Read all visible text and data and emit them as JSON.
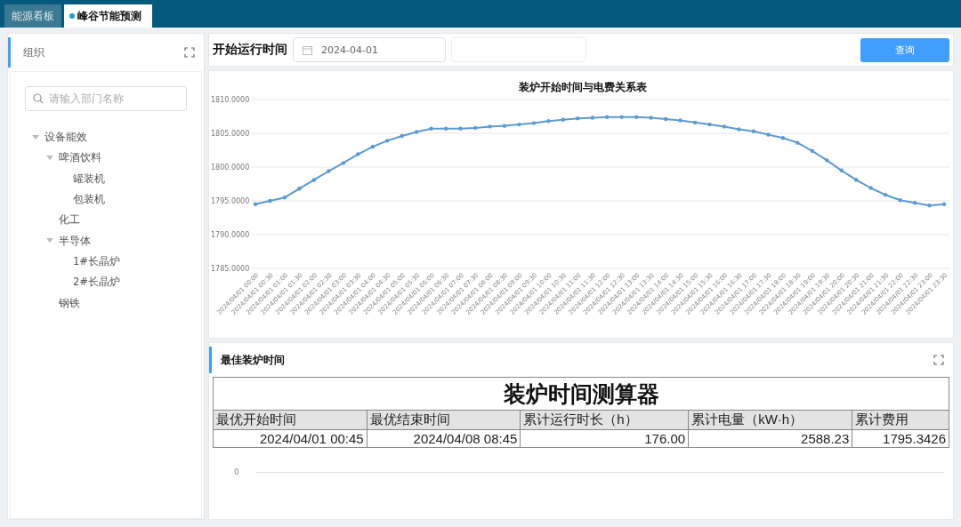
{
  "tabs": [
    {
      "label": "能源看板",
      "selected": false
    },
    {
      "label": "峰谷节能预测",
      "selected": true
    }
  ],
  "sidebar": {
    "title": "组织",
    "search": {
      "placeholder": "请输入部门名称"
    },
    "tree": [
      {
        "label": "设备能效",
        "expanded": true,
        "children": [
          {
            "label": "啤酒饮料",
            "expanded": true,
            "children": [
              {
                "label": "罐装机"
              },
              {
                "label": "包装机"
              }
            ]
          },
          {
            "label": "化工"
          },
          {
            "label": "半导体",
            "expanded": true,
            "children": [
              {
                "label": "1#长晶炉"
              },
              {
                "label": "2#长晶炉"
              }
            ]
          },
          {
            "label": "钢铁"
          }
        ]
      }
    ]
  },
  "filter": {
    "label": "开始运行时间",
    "date": "2024-04-01",
    "query_button": "查询"
  },
  "chart": {
    "chart_data": {
      "type": "line",
      "title": "装炉开始时间与电费关系表",
      "categories": [
        "2024/04/01 00:00",
        "2024/04/01 00:30",
        "2024/04/01 01:00",
        "2024/04/01 01:30",
        "2024/04/01 02:00",
        "2024/04/01 02:30",
        "2024/04/01 03:00",
        "2024/04/01 03:30",
        "2024/04/01 04:00",
        "2024/04/01 04:30",
        "2024/04/01 05:00",
        "2024/04/01 05:30",
        "2024/04/01 06:00",
        "2024/04/01 06:30",
        "2024/04/01 07:00",
        "2024/04/01 07:30",
        "2024/04/01 08:00",
        "2024/04/01 08:30",
        "2024/04/01 09:00",
        "2024/04/01 09:30",
        "2024/04/01 10:00",
        "2024/04/01 10:30",
        "2024/04/01 11:00",
        "2024/04/01 11:30",
        "2024/04/01 12:00",
        "2024/04/01 12:30",
        "2024/04/01 13:00",
        "2024/04/01 13:30",
        "2024/04/01 14:00",
        "2024/04/01 14:30",
        "2024/04/01 15:00",
        "2024/04/01 15:30",
        "2024/04/01 16:00",
        "2024/04/01 16:30",
        "2024/04/01 17:00",
        "2024/04/01 17:30",
        "2024/04/01 18:00",
        "2024/04/01 18:30",
        "2024/04/01 19:00",
        "2024/04/01 19:30",
        "2024/04/01 20:00",
        "2024/04/01 20:30",
        "2024/04/01 21:00",
        "2024/04/01 21:30",
        "2024/04/01 22:00",
        "2024/04/01 22:30",
        "2024/04/01 23:00",
        "2024/04/01 23:30"
      ],
      "grid": true,
      "series": [
        {
          "color": "#5b9bd5",
          "values": [
            1794.5,
            1795.0,
            1795.5,
            1796.8,
            1798.1,
            1799.4,
            1800.6,
            1801.9,
            1803.0,
            1803.9,
            1804.6,
            1805.2,
            1805.7,
            1805.7,
            1805.7,
            1805.8,
            1806.0,
            1806.1,
            1806.3,
            1806.5,
            1806.8,
            1807.0,
            1807.2,
            1807.3,
            1807.4,
            1807.4,
            1807.4,
            1807.3,
            1807.1,
            1806.9,
            1806.6,
            1806.3,
            1806.0,
            1805.6,
            1805.3,
            1804.8,
            1804.3,
            1803.6,
            1802.4,
            1801.0,
            1799.5,
            1798.1,
            1796.9,
            1795.9,
            1795.1,
            1794.7,
            1794.3,
            1794.5
          ]
        }
      ],
      "ylim": [
        1785,
        1810
      ],
      "yticks": [
        {
          "value": 1785,
          "label": "1785.0000"
        },
        {
          "value": 1790,
          "label": "1790.0000"
        },
        {
          "value": 1795,
          "label": "1795.0000"
        },
        {
          "value": 1800,
          "label": "1800.0000"
        },
        {
          "value": 1805,
          "label": "1805.0000"
        },
        {
          "value": 1810,
          "label": "1810.0000"
        }
      ]
    }
  },
  "best_time": {
    "title": "最佳装炉时间",
    "calculator": {
      "title": "装炉时间测算器",
      "columns": [
        "最优开始时间",
        "最优结束时间",
        "累计运行时长（h）",
        "累计电量（kW·h）",
        "累计费用"
      ],
      "rows": [
        [
          "2024/04/01 00:45",
          "2024/04/08 08:45",
          "176.00",
          "2588.23",
          "1795.3426"
        ]
      ]
    },
    "axis_label": "0"
  }
}
